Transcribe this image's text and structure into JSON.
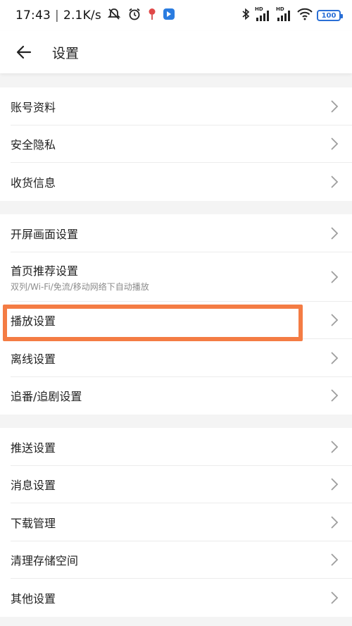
{
  "status_bar": {
    "time": "17:43",
    "net_speed": "2.1K/s",
    "battery": "100",
    "signal_label_1": "HD",
    "signal_label_2": "HD"
  },
  "header": {
    "title": "设置"
  },
  "groups": [
    {
      "items": [
        {
          "label": "账号资料"
        },
        {
          "label": "安全隐私"
        },
        {
          "label": "收货信息"
        }
      ]
    },
    {
      "items": [
        {
          "label": "开屏画面设置"
        },
        {
          "label": "首页推荐设置",
          "sub": "双列/Wi-Fi/免流/移动网络下自动播放"
        },
        {
          "label": "播放设置"
        },
        {
          "label": "离线设置"
        },
        {
          "label": "追番/追剧设置"
        }
      ]
    },
    {
      "items": [
        {
          "label": "推送设置"
        },
        {
          "label": "消息设置"
        },
        {
          "label": "下载管理"
        },
        {
          "label": "清理存储空间"
        },
        {
          "label": "其他设置"
        }
      ]
    }
  ],
  "colors": {
    "highlight": "#f47c44",
    "battery": "#2a6fd6",
    "background": "#f4f4f4"
  }
}
